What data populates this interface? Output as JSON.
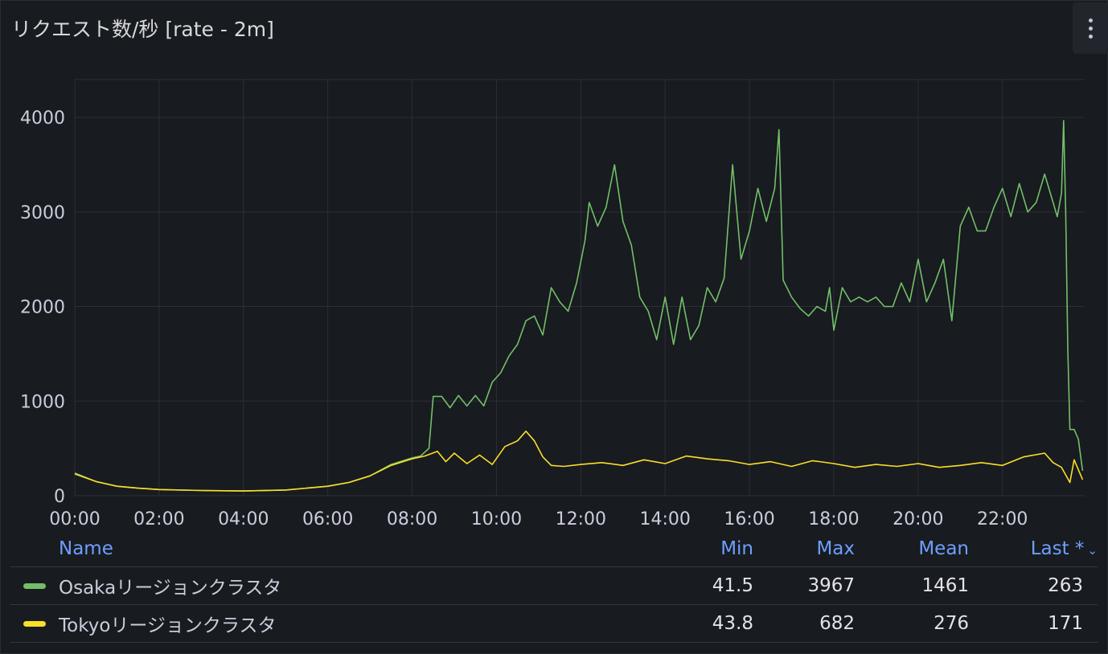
{
  "panel": {
    "title": "リクエスト数/秒 [rate - 2m]",
    "menu_icon": "vertical-ellipsis-icon"
  },
  "legend": {
    "headers": {
      "name": "Name",
      "min": "Min",
      "max": "Max",
      "mean": "Mean",
      "last": "Last *",
      "sort_icon": "chevron-down-icon"
    },
    "rows": [
      {
        "name": "Osakaリージョンクラスタ",
        "color": "#73bf69",
        "min": "41.5",
        "max": "3967",
        "mean": "1461",
        "last": "263"
      },
      {
        "name": "Tokyoリージョンクラスタ",
        "color": "#fade2a",
        "min": "43.8",
        "max": "682",
        "mean": "276",
        "last": "171"
      }
    ]
  },
  "chart_data": {
    "type": "line",
    "grid": true,
    "background": "#181b1f",
    "grid_color": "#2c2f35",
    "x_unit": "hours",
    "xlim": [
      0,
      23.95
    ],
    "ylim": [
      0,
      4400
    ],
    "x_ticks": [
      "00:00",
      "02:00",
      "04:00",
      "06:00",
      "08:00",
      "10:00",
      "12:00",
      "14:00",
      "16:00",
      "18:00",
      "20:00",
      "22:00"
    ],
    "x_tick_values": [
      0,
      2,
      4,
      6,
      8,
      10,
      12,
      14,
      16,
      18,
      20,
      22
    ],
    "y_ticks": [
      "0",
      "1000",
      "2000",
      "3000",
      "4000"
    ],
    "y_tick_values": [
      0,
      1000,
      2000,
      3000,
      4000
    ],
    "series": [
      {
        "name": "Osakaリージョンクラスタ",
        "color": "#73bf69",
        "x": [
          0,
          0.5,
          1,
          1.5,
          2,
          3,
          4,
          5,
          6,
          6.5,
          7,
          7.5,
          8,
          8.2,
          8.4,
          8.5,
          8.7,
          8.9,
          9.1,
          9.3,
          9.5,
          9.7,
          9.9,
          10.1,
          10.3,
          10.5,
          10.7,
          10.9,
          11.1,
          11.3,
          11.5,
          11.7,
          11.9,
          12.1,
          12.2,
          12.4,
          12.6,
          12.8,
          13,
          13.2,
          13.4,
          13.6,
          13.8,
          14,
          14.2,
          14.4,
          14.6,
          14.8,
          15,
          15.2,
          15.4,
          15.6,
          15.8,
          16,
          16.2,
          16.4,
          16.6,
          16.7,
          16.8,
          17,
          17.2,
          17.4,
          17.6,
          17.8,
          17.9,
          18,
          18.2,
          18.4,
          18.6,
          18.8,
          19,
          19.2,
          19.4,
          19.6,
          19.8,
          20,
          20.2,
          20.4,
          20.6,
          20.8,
          21,
          21.2,
          21.4,
          21.6,
          21.8,
          22,
          22.2,
          22.4,
          22.6,
          22.8,
          23,
          23.2,
          23.3,
          23.4,
          23.45,
          23.5,
          23.55,
          23.6,
          23.7,
          23.8,
          23.9
        ],
        "values": [
          240,
          150,
          100,
          80,
          65,
          55,
          50,
          60,
          100,
          140,
          210,
          330,
          400,
          420,
          500,
          1050,
          1050,
          930,
          1060,
          950,
          1060,
          950,
          1200,
          1300,
          1480,
          1600,
          1850,
          1900,
          1700,
          2200,
          2050,
          1950,
          2250,
          2700,
          3100,
          2850,
          3050,
          3500,
          2900,
          2650,
          2100,
          1950,
          1650,
          2100,
          1600,
          2100,
          1650,
          1800,
          2200,
          2050,
          2300,
          3500,
          2500,
          2800,
          3250,
          2900,
          3250,
          3870,
          2280,
          2100,
          1980,
          1900,
          2000,
          1950,
          2200,
          1750,
          2200,
          2050,
          2100,
          2050,
          2100,
          2000,
          2000,
          2250,
          2050,
          2500,
          2050,
          2250,
          2500,
          1850,
          2850,
          3050,
          2800,
          2800,
          3050,
          3250,
          2950,
          3300,
          3000,
          3100,
          3400,
          3100,
          2950,
          3200,
          3967,
          3000,
          1550,
          700,
          700,
          600,
          263
        ]
      },
      {
        "name": "Tokyoリージョンクラスタ",
        "color": "#fade2a",
        "x": [
          0,
          0.5,
          1,
          1.5,
          2,
          3,
          4,
          5,
          6,
          6.5,
          7,
          7.5,
          8,
          8.3,
          8.6,
          8.8,
          9,
          9.3,
          9.6,
          9.9,
          10.2,
          10.5,
          10.7,
          10.9,
          11.1,
          11.3,
          11.6,
          12,
          12.5,
          13,
          13.5,
          14,
          14.5,
          15,
          15.5,
          16,
          16.5,
          17,
          17.5,
          18,
          18.5,
          19,
          19.5,
          20,
          20.5,
          21,
          21.5,
          22,
          22.5,
          23,
          23.2,
          23.4,
          23.6,
          23.7,
          23.9
        ],
        "values": [
          230,
          150,
          100,
          80,
          65,
          55,
          50,
          60,
          100,
          140,
          210,
          320,
          390,
          420,
          470,
          360,
          450,
          340,
          430,
          330,
          520,
          580,
          682,
          580,
          410,
          320,
          310,
          330,
          350,
          320,
          380,
          340,
          420,
          390,
          370,
          330,
          360,
          310,
          370,
          340,
          300,
          330,
          310,
          340,
          300,
          320,
          350,
          320,
          410,
          450,
          350,
          300,
          140,
          380,
          171
        ]
      }
    ]
  }
}
